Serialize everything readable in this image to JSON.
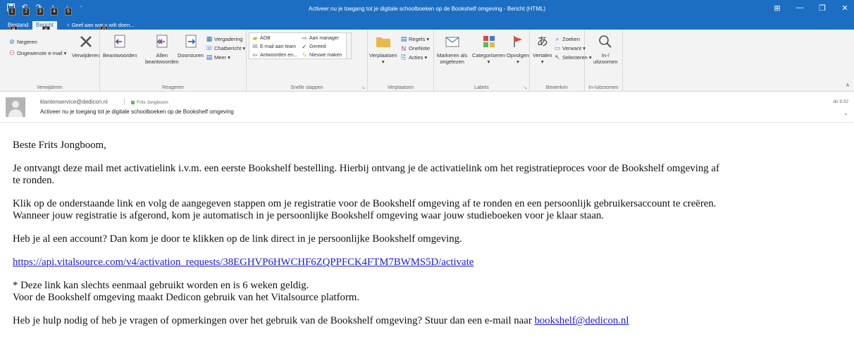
{
  "window": {
    "title": "Activeer nu je toegang tot je digitale schoolboeken op de Bookshelf omgeving  -  Bericht (HTML)",
    "qat_keytips": [
      "1",
      "2",
      "3",
      "4",
      "5"
    ],
    "controls": {
      "ribbon_options": "⊞",
      "minimize": "—",
      "restore": "❐",
      "close": "✕"
    }
  },
  "tabs": {
    "file": {
      "label": "Bestand",
      "keytip": "B"
    },
    "message": {
      "label": "Bericht",
      "keytip": "B"
    },
    "tell_me": {
      "label": "Geef aan wat u wilt doen...",
      "keytip": "Q"
    }
  },
  "ribbon": {
    "delete_group": {
      "label": "Verwijderen",
      "ignore": "Negeren",
      "junk": "Ongewenste e-mail",
      "delete": "Verwijderen"
    },
    "respond_group": {
      "label": "Reageren",
      "reply": "Beantwoorden",
      "reply_all_1": "Allen",
      "reply_all_2": "beantwoorden",
      "forward": "Doorsturen",
      "meeting": "Vergadering",
      "im": "Chatbericht",
      "more": "Meer"
    },
    "quicksteps_group": {
      "label": "Snelle stappen",
      "items": [
        "AOB",
        "Aan manager",
        "E-mail aan team",
        "Gereed",
        "Antwoorden en...",
        "Nieuwe maken"
      ]
    },
    "move_group": {
      "label": "Verplaatsen",
      "move": "Verplaatsen",
      "rules": "Regels",
      "onenote": "OneNote",
      "actions": "Acties"
    },
    "tags_group": {
      "label": "Labels",
      "mark_unread_1": "Markeren als",
      "mark_unread_2": "ongelezen",
      "categorize": "Categoriseren",
      "follow_up": "Opvolgen"
    },
    "editing_group": {
      "label": "Bewerken",
      "translate": "Vertalen",
      "find": "Zoeken",
      "related": "Verwant",
      "select": "Selecteren"
    },
    "zoom_group": {
      "label": "In-/uitzoomen",
      "zoom_1": "In-/",
      "zoom_2": "uitzoomen"
    }
  },
  "message": {
    "sender": "klantenservice@dedicon.nl",
    "to": "Frits Jongboom",
    "subject": "Activeer nu je toegang tot je digitale schoolboeken op de Bookshelf omgeving",
    "time": "do 9:32",
    "body": {
      "greeting": "Beste Frits Jongboom,",
      "p1_line1": "Je ontvangt deze mail met activatielink i.v.m. een eerste Bookshelf bestelling. Hierbij ontvang je de activatielink om het registratieproces voor de Bookshelf omgeving af",
      "p1_line2": "te ronden.",
      "p2_line1": "Klik op de onderstaande link en volg de aangegeven stappen om je registratie voor de Bookshelf omgeving af te ronden en een persoonlijk gebruikersaccount te creëren.",
      "p2_line2": "Wanneer jouw registratie is afgerond, kom je automatisch in je persoonlijke Bookshelf omgeving waar jouw studieboeken voor je klaar staan.",
      "p3": "Heb je al een account? Dan kom je door te klikken op de link direct in je persoonlijke Bookshelf omgeving.",
      "activation_link": "https://api.vitalsource.com/v4/activation_requests/38EGHVP6HWCHF6ZQPPFCK4FTM7BWMS5D/activate",
      "note_line1": "* Deze link kan slechts eenmaal gebruikt worden en is 6 weken geldig.",
      "note_line2": "Voor de Bookshelf omgeving maakt Dedicon gebruik van het Vitalsource platform.",
      "help_text": "Heb je hulp nodig of heb je vragen of opmerkingen over het gebruik van de Bookshelf omgeving? Stuur dan een e-mail naar ",
      "help_email": "bookshelf@dedicon.nl"
    }
  },
  "colors": {
    "titlebar": "#1c6ec2",
    "ribbon": "#f3f3f3",
    "link": "#1a1ad6",
    "category_green": "#5cb85c",
    "flag_red": "#e0443e"
  }
}
